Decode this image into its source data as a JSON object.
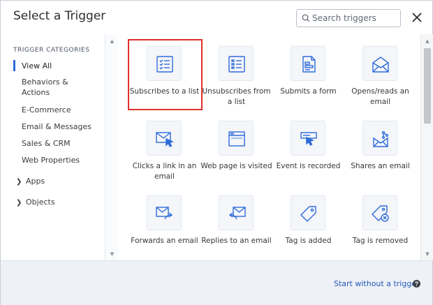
{
  "header": {
    "title": "Select a Trigger",
    "search_placeholder": "Search triggers"
  },
  "sidebar": {
    "heading": "TRIGGER CATEGORIES",
    "items": [
      {
        "label": "View All",
        "active": true
      },
      {
        "label": "Behaviors &\nActions"
      },
      {
        "label": "E-Commerce"
      },
      {
        "label": "Email & Messages"
      },
      {
        "label": "Sales & CRM"
      },
      {
        "label": "Web Properties"
      }
    ],
    "expanders": [
      {
        "label": "Apps"
      },
      {
        "label": "Objects"
      }
    ]
  },
  "triggers": [
    {
      "label": "Subscribes to a list",
      "icon": "list-check-icon",
      "selected": true
    },
    {
      "label": "Unsubscribes from a list",
      "icon": "list-icon"
    },
    {
      "label": "Submits a form",
      "icon": "form-icon"
    },
    {
      "label": "Opens/reads an email",
      "icon": "open-envelope-icon"
    },
    {
      "label": "Clicks a link in an email",
      "icon": "envelope-cursor-icon"
    },
    {
      "label": "Web page is visited",
      "icon": "browser-window-icon"
    },
    {
      "label": "Event is recorded",
      "icon": "event-cursor-icon"
    },
    {
      "label": "Shares an email",
      "icon": "share-envelope-icon"
    },
    {
      "label": "Forwards an email",
      "icon": "forward-envelope-icon"
    },
    {
      "label": "Replies to an email",
      "icon": "reply-envelope-icon"
    },
    {
      "label": "Tag is added",
      "icon": "tag-icon"
    },
    {
      "label": "Tag is removed",
      "icon": "tag-remove-icon"
    }
  ],
  "footer": {
    "start_without": "Start without a trigger"
  },
  "colors": {
    "accent": "#2e6bd9",
    "icon": "#2e6bd9",
    "selected_border": "#e0302b",
    "footer_bg": "#eef1f6"
  }
}
